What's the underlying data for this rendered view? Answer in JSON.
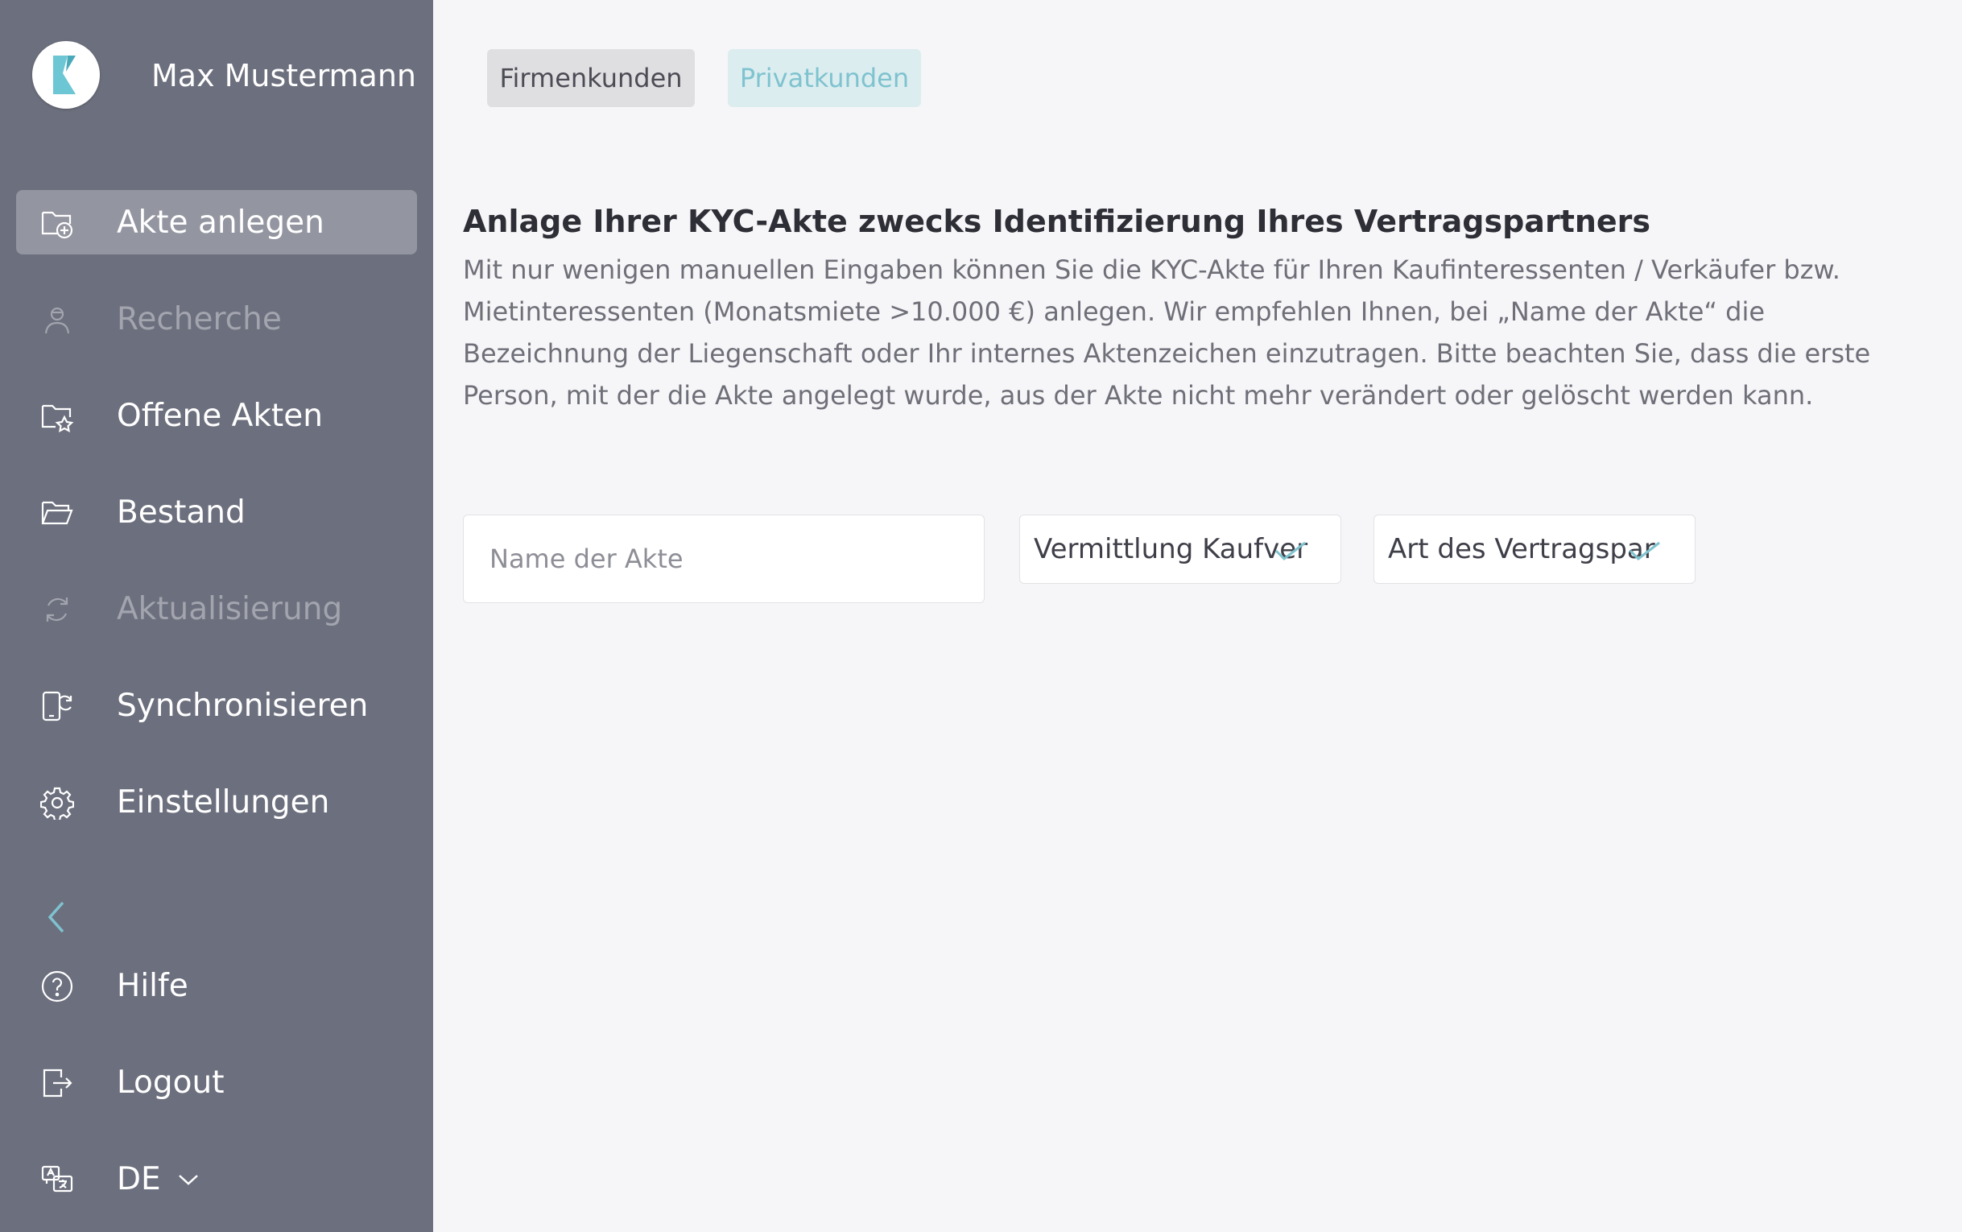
{
  "user": {
    "name": "Max Mustermann"
  },
  "nav": {
    "items": [
      {
        "label": "Akte anlegen"
      },
      {
        "label": "Recherche"
      },
      {
        "label": "Offene Akten"
      },
      {
        "label": "Bestand"
      },
      {
        "label": "Aktualisierung"
      },
      {
        "label": "Synchronisieren"
      },
      {
        "label": "Einstellungen"
      }
    ],
    "bottom": [
      {
        "label": "Hilfe"
      },
      {
        "label": "Logout"
      },
      {
        "label": "DE"
      }
    ]
  },
  "tabs": [
    {
      "label": "Firmenkunden"
    },
    {
      "label": "Privatkunden"
    }
  ],
  "main": {
    "heading": "Anlage Ihrer KYC-Akte zwecks Identifizierung Ihres Vertragspartners",
    "description": "Mit nur wenigen manuellen Eingaben können Sie die KYC-Akte für Ihren Kaufinteressenten / Verkäufer bzw. Mietinteressenten (Monatsmiete >10.000 €) anlegen. Wir empfehlen Ihnen, bei „Name der Akte“ die Bezeichnung der Liegenschaft oder Ihr internes Aktenzeichen einzutragen. Bitte beachten Sie, dass die erste Person, mit der die Akte angelegt wurde, aus der Akte nicht mehr verändert oder gelöscht werden kann."
  },
  "form": {
    "name_placeholder": "Name der Akte",
    "select1_value": "Vermittlung Kaufver",
    "select2_value": "Art des Vertragspar"
  },
  "colors": {
    "sidebar": "#6c6f7d",
    "accent": "#7ec3cf",
    "active_item": "#9395a0"
  }
}
